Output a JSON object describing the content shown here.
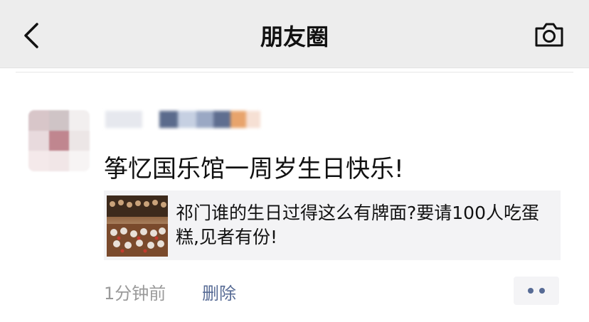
{
  "header": {
    "title": "朋友圈",
    "back_icon": "chevron-left-icon",
    "camera_icon": "camera-icon"
  },
  "post": {
    "text": "筝忆国乐馆一周岁生日快乐!",
    "link": {
      "title": "祁门谁的生日过得这么有牌面?要请100人吃蛋糕,见者有份!"
    },
    "time": "1分钟前",
    "delete_label": "删除",
    "more_icon": "more-dots-icon"
  },
  "colors": {
    "link_blue": "#576b95",
    "header_bg": "#ededed",
    "card_bg": "#f3f3f5"
  }
}
